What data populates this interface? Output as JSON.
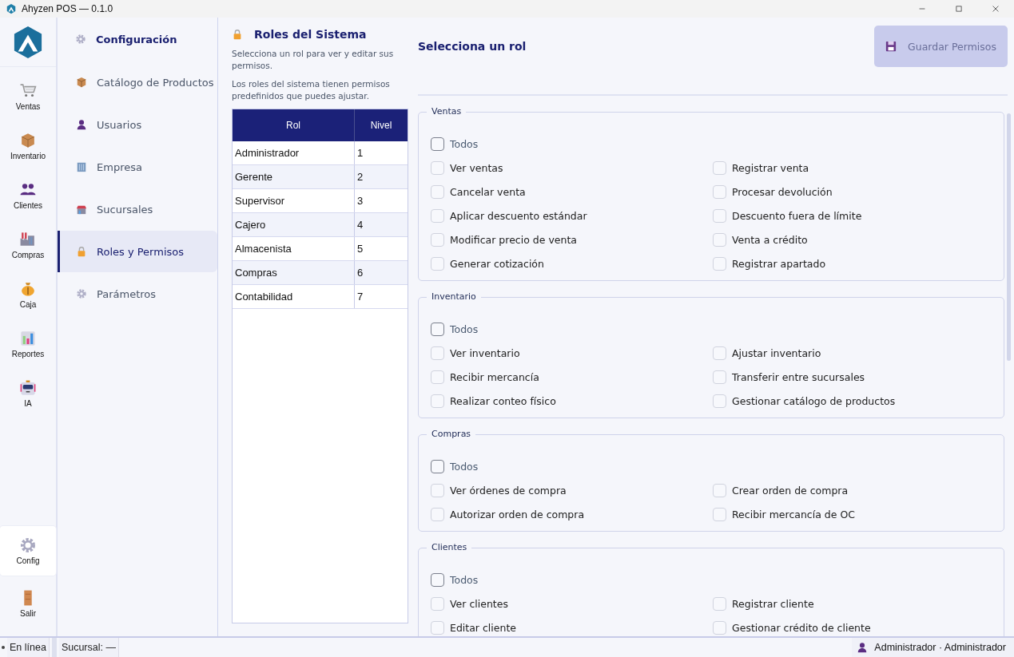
{
  "window": {
    "title": "Ahyzen POS — 0.1.0"
  },
  "rail": {
    "items": [
      {
        "label": "Ventas",
        "selected": false
      },
      {
        "label": "Inventario",
        "selected": false
      },
      {
        "label": "Clientes",
        "selected": false
      },
      {
        "label": "Compras",
        "selected": false
      },
      {
        "label": "Caja",
        "selected": false
      },
      {
        "label": "Reportes",
        "selected": false
      },
      {
        "label": "IA",
        "selected": false
      }
    ],
    "bottom_items": [
      {
        "label": "Config",
        "selected": true
      },
      {
        "label": "Salir",
        "selected": false
      }
    ]
  },
  "config_menu": {
    "title": "Configuración",
    "items": [
      {
        "label": "Catálogo de Productos",
        "selected": false
      },
      {
        "label": "Usuarios",
        "selected": false
      },
      {
        "label": "Empresa",
        "selected": false
      },
      {
        "label": "Sucursales",
        "selected": false
      },
      {
        "label": "Roles y Permisos",
        "selected": true
      },
      {
        "label": "Parámetros",
        "selected": false
      }
    ]
  },
  "roles_panel": {
    "title": "Roles del Sistema",
    "description": [
      "Selecciona un rol para ver y editar sus permisos.",
      "Los roles del sistema tienen permisos predefinidos que puedes ajustar."
    ],
    "table": {
      "columns": [
        "Rol",
        "Nivel"
      ],
      "rows": [
        [
          "Administrador",
          "1"
        ],
        [
          "Gerente",
          "2"
        ],
        [
          "Supervisor",
          "3"
        ],
        [
          "Cajero",
          "4"
        ],
        [
          "Almacenista",
          "5"
        ],
        [
          "Compras",
          "6"
        ],
        [
          "Contabilidad",
          "7"
        ]
      ]
    }
  },
  "permissions": {
    "heading": "Selecciona un rol",
    "save_button": {
      "label": "Guardar Permisos",
      "disabled": true
    },
    "groups": [
      {
        "title": "Ventas",
        "all": {
          "label": "Todos",
          "checked": false
        },
        "items": [
          {
            "label": "Ver ventas",
            "checked": false
          },
          {
            "label": "Registrar venta",
            "checked": false
          },
          {
            "label": "Cancelar venta",
            "checked": false
          },
          {
            "label": "Procesar devolución",
            "checked": false
          },
          {
            "label": "Aplicar descuento estándar",
            "checked": false
          },
          {
            "label": "Descuento fuera de límite",
            "checked": false
          },
          {
            "label": "Modificar precio de venta",
            "checked": false
          },
          {
            "label": "Venta a crédito",
            "checked": false
          },
          {
            "label": "Generar cotización",
            "checked": false
          },
          {
            "label": "Registrar apartado",
            "checked": false
          }
        ]
      },
      {
        "title": "Inventario",
        "all": {
          "label": "Todos",
          "checked": false
        },
        "items": [
          {
            "label": "Ver inventario",
            "checked": false
          },
          {
            "label": "Ajustar inventario",
            "checked": false
          },
          {
            "label": "Recibir mercancía",
            "checked": false
          },
          {
            "label": "Transferir entre sucursales",
            "checked": false
          },
          {
            "label": "Realizar conteo físico",
            "checked": false
          },
          {
            "label": "Gestionar catálogo de productos",
            "checked": false
          }
        ]
      },
      {
        "title": "Compras",
        "all": {
          "label": "Todos",
          "checked": false
        },
        "items": [
          {
            "label": "Ver órdenes de compra",
            "checked": false
          },
          {
            "label": "Crear orden de compra",
            "checked": false
          },
          {
            "label": "Autorizar orden de compra",
            "checked": false
          },
          {
            "label": "Recibir mercancía de OC",
            "checked": false
          }
        ]
      },
      {
        "title": "Clientes",
        "all": {
          "label": "Todos",
          "checked": false
        },
        "items": [
          {
            "label": "Ver clientes",
            "checked": false
          },
          {
            "label": "Registrar cliente",
            "checked": false
          },
          {
            "label": "Editar cliente",
            "checked": false
          },
          {
            "label": "Gestionar crédito de cliente",
            "checked": false
          }
        ]
      }
    ]
  },
  "status_bar": {
    "connection": "En línea",
    "branch": "Sucursal: —",
    "user": "Administrador · Administrador"
  }
}
